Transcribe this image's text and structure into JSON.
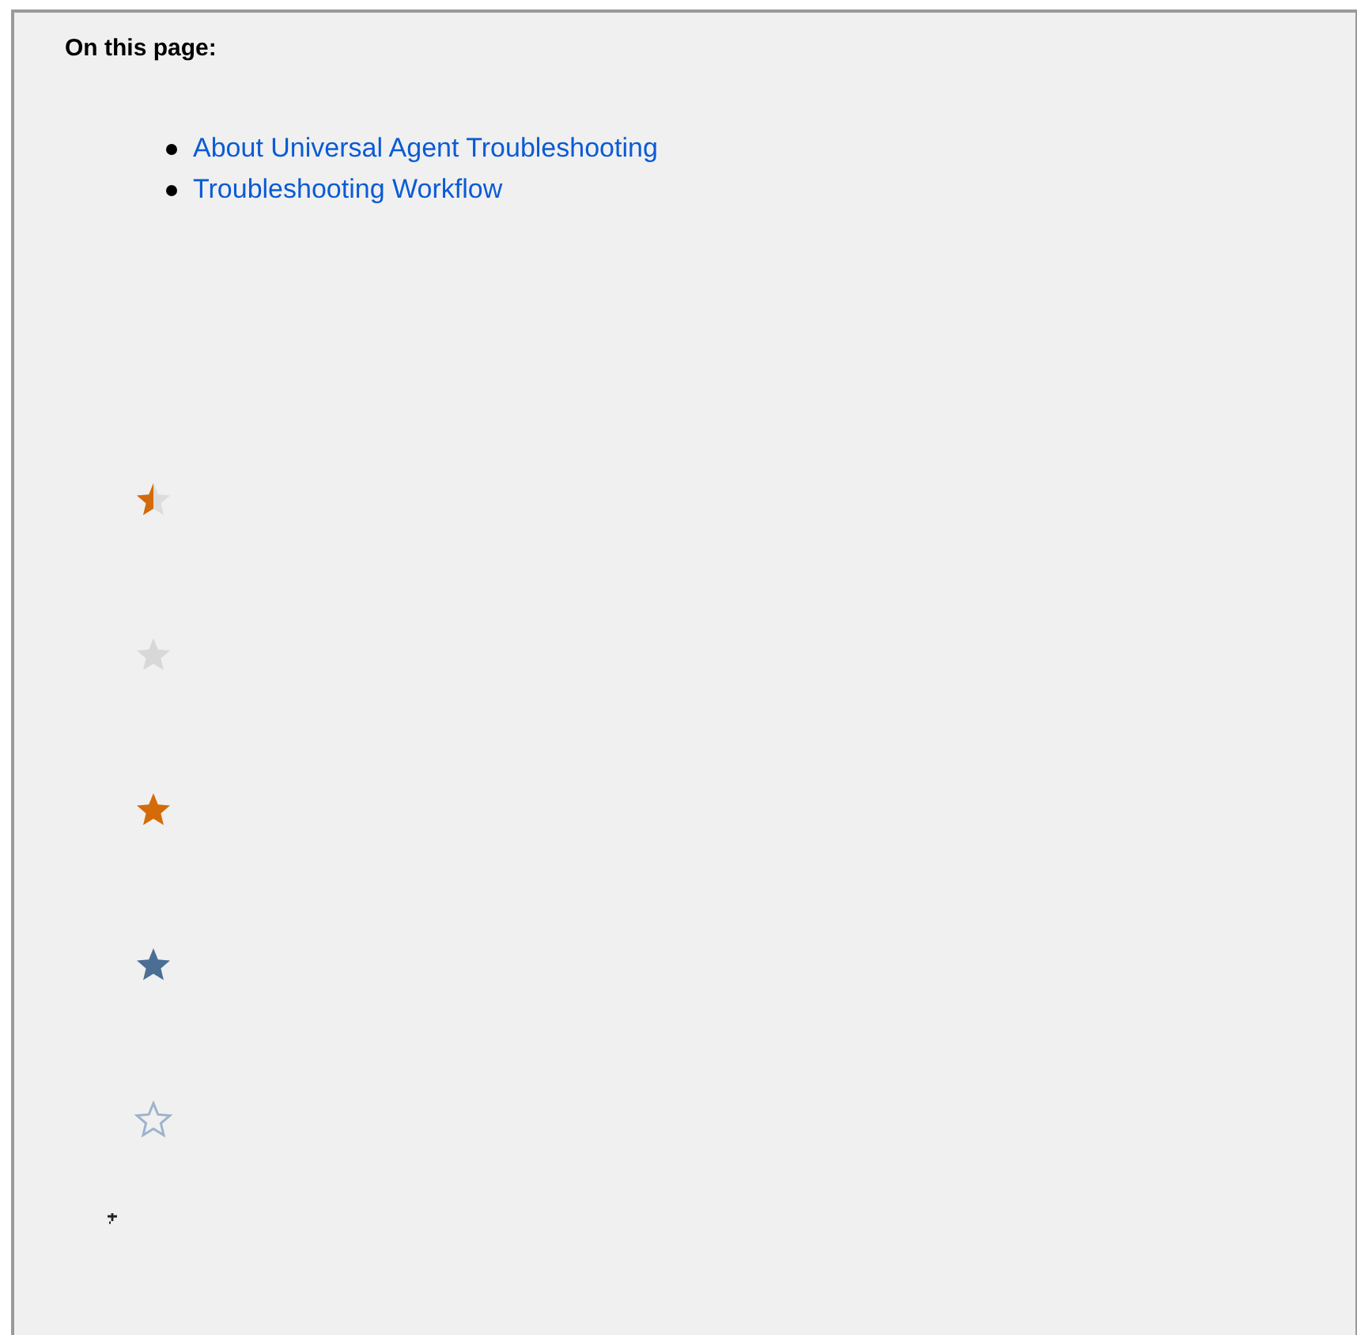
{
  "toc": {
    "heading": "On this page:",
    "links": [
      "About Universal Agent Troubleshooting",
      "Troubleshooting Workflow"
    ]
  },
  "stars": [
    {
      "kind": "half"
    },
    {
      "kind": "grey"
    },
    {
      "kind": "orange"
    },
    {
      "kind": "blue"
    },
    {
      "kind": "outline"
    }
  ]
}
